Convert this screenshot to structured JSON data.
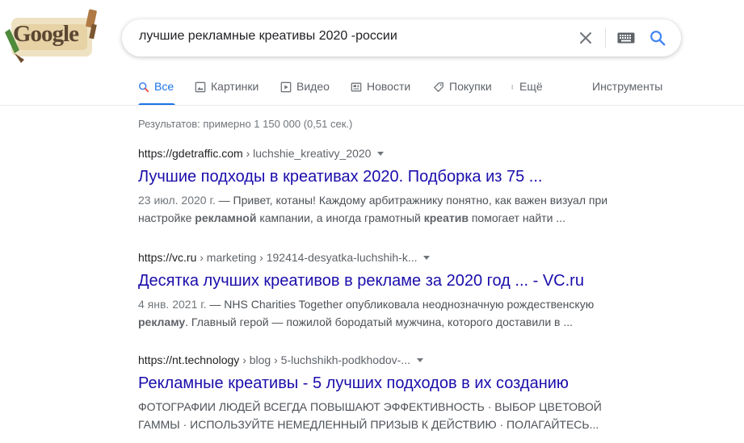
{
  "logo": {
    "text": "Google"
  },
  "search": {
    "query": "лучшие рекламные креативы 2020 -россии"
  },
  "tabs": [
    {
      "label": "Все",
      "icon": "search-icon",
      "active": true
    },
    {
      "label": "Картинки",
      "icon": "image-icon"
    },
    {
      "label": "Видео",
      "icon": "video-icon"
    },
    {
      "label": "Новости",
      "icon": "news-icon"
    },
    {
      "label": "Покупки",
      "icon": "tag-icon"
    },
    {
      "label": "Ещё",
      "icon": "more-icon"
    }
  ],
  "tools_label": "Инструменты",
  "stats": "Результатов: примерно 1 150 000 (0,51 сек.)",
  "results": [
    {
      "site": "https://gdetraffic.com",
      "path": " › luchshie_kreativy_2020",
      "title": "Лучшие подходы в креативах 2020. Подборка из 75 ...",
      "date": "23 июл. 2020 г.",
      "s1": " — Привет, котаны! Каждому арбитражнику понятно, как важен визуал при",
      "s2a": "настройке ",
      "s2b": "рекламной",
      "s2c": " кампании, а иногда грамотный ",
      "s2d": "креатив",
      "s2e": " помогает найти ..."
    },
    {
      "site": "https://vc.ru",
      "path": " › marketing › 192414-desyatka-luchshih-k...",
      "title": "Десятка лучших креативов в рекламе за 2020 год ... - VC.ru",
      "date": "4 янв. 2021 г.",
      "s1": " — NHS Charities Together опубликовала неоднозначную рождественскую",
      "s2a": "",
      "s2b": "рекламу",
      "s2c": ". Главный герой — пожилой бородатый мужчина, которого доставили в ...",
      "s2d": "",
      "s2e": ""
    },
    {
      "site": "https://nt.technology",
      "path": " › blog › 5-luchshikh-podkhodov-...",
      "title": "Рекламные креативы - 5 лучших подходов в их созданию",
      "s1": "ФОТОГРАФИИ ЛЮДЕЙ ВСЕГДА ПОВЫШАЮТ ЭФФЕКТИВНОСТЬ · ВЫБОР ЦВЕТОВОЙ",
      "s2": "ГАММЫ · ИСПОЛЬЗУЙТЕ НЕМЕДЛЕННЫЙ ПРИЗЫВ К ДЕЙСТВИЮ · ПОЛАГАЙТЕСЬ..."
    }
  ]
}
